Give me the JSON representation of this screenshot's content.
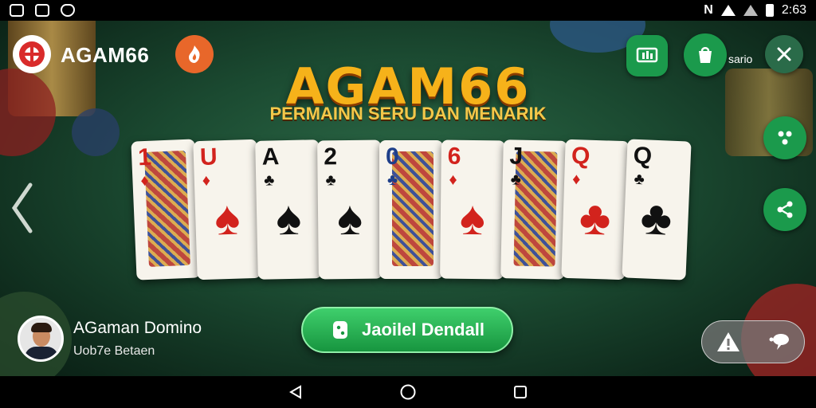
{
  "status_bar": {
    "time": "2:63"
  },
  "header": {
    "brand": "AGAM66",
    "top_right_label": "sario"
  },
  "hero": {
    "title": "AGAM66",
    "subtitle": "PERMAINN SERU DAN MENARIK"
  },
  "cards": [
    {
      "rank": "1",
      "suit": "♦",
      "color": "#d2231d",
      "face": true
    },
    {
      "rank": "U",
      "suit": "♦",
      "color": "#d2231d",
      "big": "♠"
    },
    {
      "rank": "A",
      "suit": "♣",
      "color": "#111111",
      "big": "♠"
    },
    {
      "rank": "2",
      "suit": "♣",
      "color": "#111111",
      "big": "♠"
    },
    {
      "rank": "0",
      "suit": "♣",
      "color": "#1e3f8a",
      "face": true
    },
    {
      "rank": "6",
      "suit": "♦",
      "color": "#d2231d",
      "big": "♠"
    },
    {
      "rank": "J",
      "suit": "♣",
      "color": "#111111",
      "face": true
    },
    {
      "rank": "Q",
      "suit": "♦",
      "color": "#d2231d",
      "big": "♣"
    },
    {
      "rank": "Q",
      "suit": "♣",
      "color": "#111111",
      "big": "♣"
    }
  ],
  "player": {
    "name": "AGaman Domino",
    "subtitle": "Uob7e Betaen"
  },
  "cta": {
    "label": "Jaoilel Dendall"
  },
  "icons": {
    "brand_logo": "club-badge-icon",
    "flame": "flame-icon",
    "leaderboard": "tv-icon",
    "shop": "shop-bag-icon",
    "close": "close-icon",
    "players": "people-icon",
    "share": "share-icon",
    "back": "chevron-left-icon"
  },
  "colors": {
    "accent_green": "#1b9a4c",
    "title_gold": "#f6b21a",
    "table_green": "#1b4a31"
  }
}
